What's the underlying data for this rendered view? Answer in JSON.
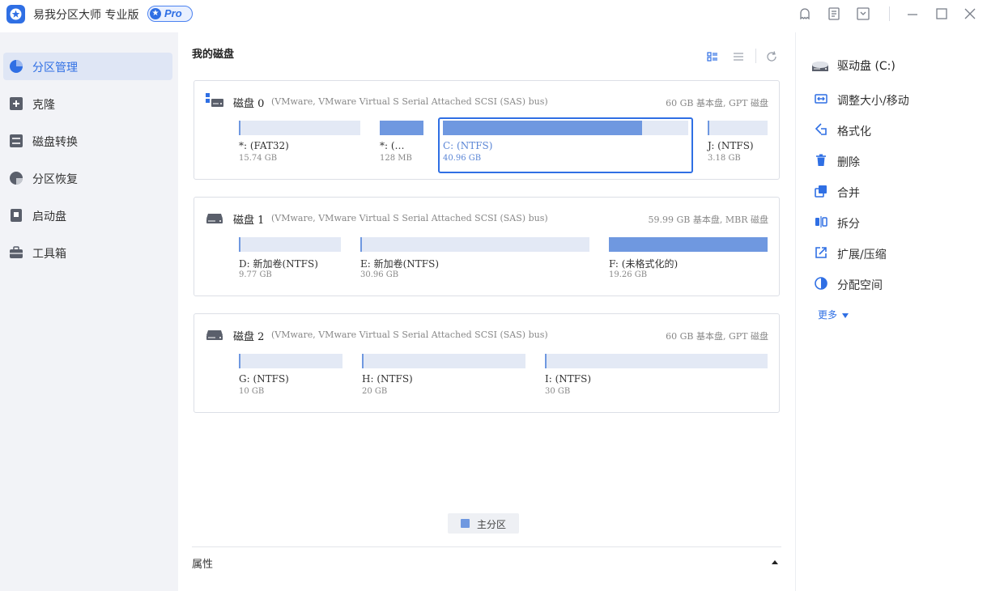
{
  "app": {
    "title": "易我分区大师 专业版",
    "badge": "Pro"
  },
  "colors": {
    "accent": "#2f6fe4",
    "partition_fill": "#6f98e0",
    "partition_empty": "#e3e9f5"
  },
  "titlebar": {
    "icons": [
      "skin-icon",
      "feedback-icon",
      "menu-dropdown-icon",
      "minimize-icon",
      "maximize-icon",
      "close-icon"
    ]
  },
  "sidebar": {
    "items": [
      {
        "label": "分区管理",
        "icon": "pie-chart-icon",
        "active": true
      },
      {
        "label": "克隆",
        "icon": "clone-icon",
        "active": false
      },
      {
        "label": "磁盘转换",
        "icon": "convert-icon",
        "active": false
      },
      {
        "label": "分区恢复",
        "icon": "recovery-icon",
        "active": false
      },
      {
        "label": "启动盘",
        "icon": "boot-disk-icon",
        "active": false
      },
      {
        "label": "工具箱",
        "icon": "toolbox-icon",
        "active": false
      }
    ]
  },
  "main": {
    "title": "我的磁盘",
    "disks": [
      {
        "name": "磁盘 0",
        "model": "(VMware,  VMware Virtual S Serial Attached SCSI (SAS) bus)",
        "info": "60 GB 基本盘, GPT 磁盘",
        "partitions": [
          {
            "label": "*: (FAT32)",
            "size": "15.74 GB",
            "used_fraction": 0.0
          },
          {
            "label": "*: (…",
            "size": "128 MB",
            "used_fraction": 1.0
          },
          {
            "label": "C: (NTFS)",
            "size": "40.96 GB",
            "used_fraction": 0.81,
            "selected": true
          },
          {
            "label": "J: (NTFS)",
            "size": "3.18 GB",
            "used_fraction": 0.0
          }
        ]
      },
      {
        "name": "磁盘 1",
        "model": "(VMware,  VMware Virtual S Serial Attached SCSI (SAS) bus)",
        "info": "59.99 GB 基本盘, MBR 磁盘",
        "partitions": [
          {
            "label": "D: 新加卷(NTFS)",
            "size": "9.77 GB",
            "used_fraction": 0.0
          },
          {
            "label": "E: 新加卷(NTFS)",
            "size": "30.96 GB",
            "used_fraction": 0.0
          },
          {
            "label": "F: (未格式化的)",
            "size": "19.26 GB",
            "used_fraction": 1.0
          }
        ]
      },
      {
        "name": "磁盘 2",
        "model": "(VMware,  VMware Virtual S Serial Attached SCSI (SAS) bus)",
        "info": "60 GB 基本盘, GPT 磁盘",
        "partitions": [
          {
            "label": "G: (NTFS)",
            "size": "10 GB",
            "used_fraction": 0.0
          },
          {
            "label": "H: (NTFS)",
            "size": "20 GB",
            "used_fraction": 0.0
          },
          {
            "label": "I: (NTFS)",
            "size": "30 GB",
            "used_fraction": 0.0
          }
        ]
      }
    ],
    "legend": "主分区",
    "properties_label": "属性"
  },
  "right_panel": {
    "header": "驱动盘  (C:)",
    "actions": [
      {
        "label": "调整大小/移动",
        "icon": "resize-icon"
      },
      {
        "label": "格式化",
        "icon": "format-icon"
      },
      {
        "label": "删除",
        "icon": "trash-icon"
      },
      {
        "label": "合并",
        "icon": "merge-icon"
      },
      {
        "label": "拆分",
        "icon": "split-icon"
      },
      {
        "label": "扩展/压缩",
        "icon": "extend-shrink-icon"
      },
      {
        "label": "分配空间",
        "icon": "allocate-space-icon"
      }
    ],
    "more": "更多"
  }
}
